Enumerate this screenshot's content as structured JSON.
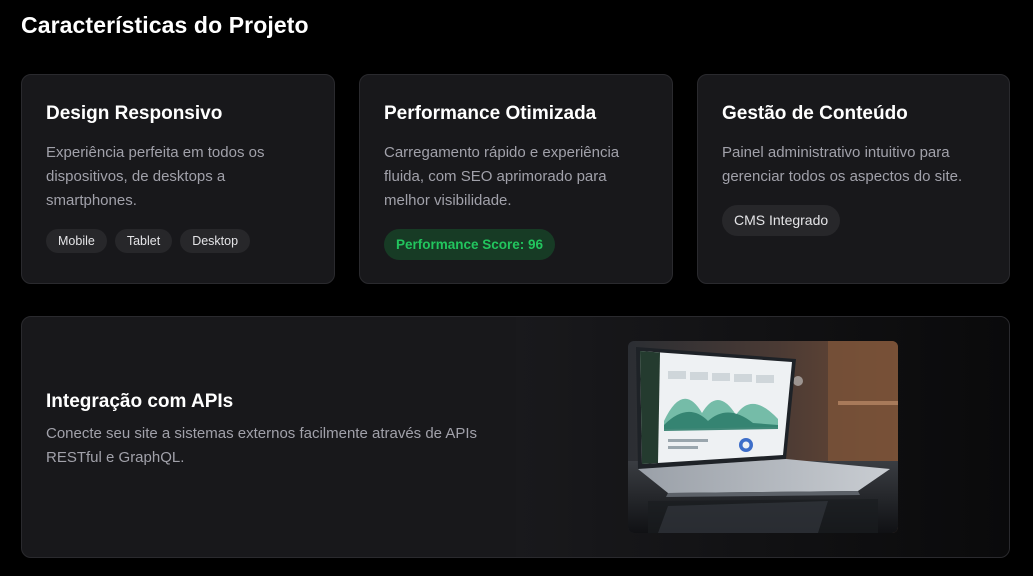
{
  "section": {
    "title": "Características do Projeto"
  },
  "cards": [
    {
      "title": "Design Responsivo",
      "description": "Experiência perfeita em todos os dispositivos, de desktops a smartphones.",
      "tags": [
        "Mobile",
        "Tablet",
        "Desktop"
      ]
    },
    {
      "title": "Performance Otimizada",
      "description": "Carregamento rápido e experiência fluida, com SEO aprimorado para melhor visibilidade.",
      "badge": "Performance Score: 96"
    },
    {
      "title": "Gestão de Conteúdo",
      "description": "Painel administrativo intuitivo para gerenciar todos os aspectos do site.",
      "badge": "CMS Integrado"
    }
  ],
  "api_card": {
    "title": "Integração com APIs",
    "description": "Conecte seu site a sistemas externos facilmente através de APIs RESTful e GraphQL.",
    "image": "laptop-dashboard-photo"
  },
  "colors": {
    "background": "#000000",
    "card": "#18181b",
    "border": "#2a2a2e",
    "muted_text": "#a1a1aa",
    "success": "#22c55e"
  }
}
